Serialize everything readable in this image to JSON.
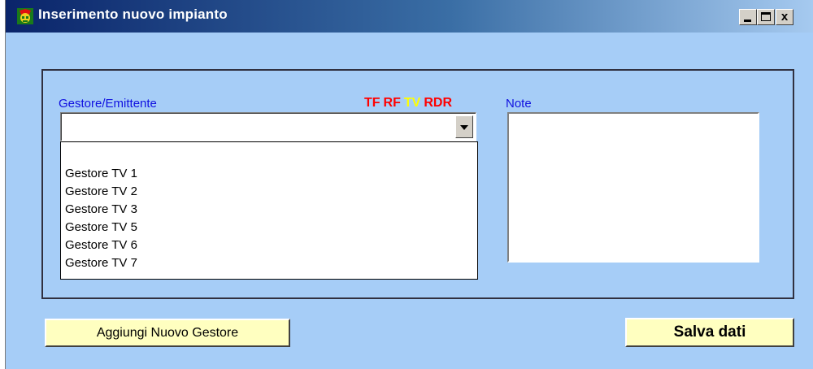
{
  "window": {
    "title": "Inserimento nuovo impianto",
    "controls": {
      "minimize": "_",
      "maximize": "□",
      "close": "x"
    }
  },
  "form": {
    "gestore_label": "Gestore/Emittente",
    "flags": [
      {
        "text": "TF",
        "color": "#ff0000"
      },
      {
        "text": "RF",
        "color": "#ff0000"
      },
      {
        "text": "TV",
        "color": "#ffff00"
      },
      {
        "text": "RDR",
        "color": "#ff0000"
      }
    ],
    "combo_value": "",
    "list_items": [
      "Gestore TV 1",
      "Gestore TV 2",
      "Gestore TV 3",
      "Gestore TV 5",
      "Gestore TV 6",
      "Gestore TV 7"
    ],
    "note_label": "Note",
    "note_value": ""
  },
  "buttons": {
    "add_gestore": "Aggiungi Nuovo Gestore",
    "save": "Salva dati"
  },
  "colors": {
    "window_bg": "#a6cdf7",
    "button_bg": "#ffffc0",
    "label_color": "#1010e0"
  }
}
